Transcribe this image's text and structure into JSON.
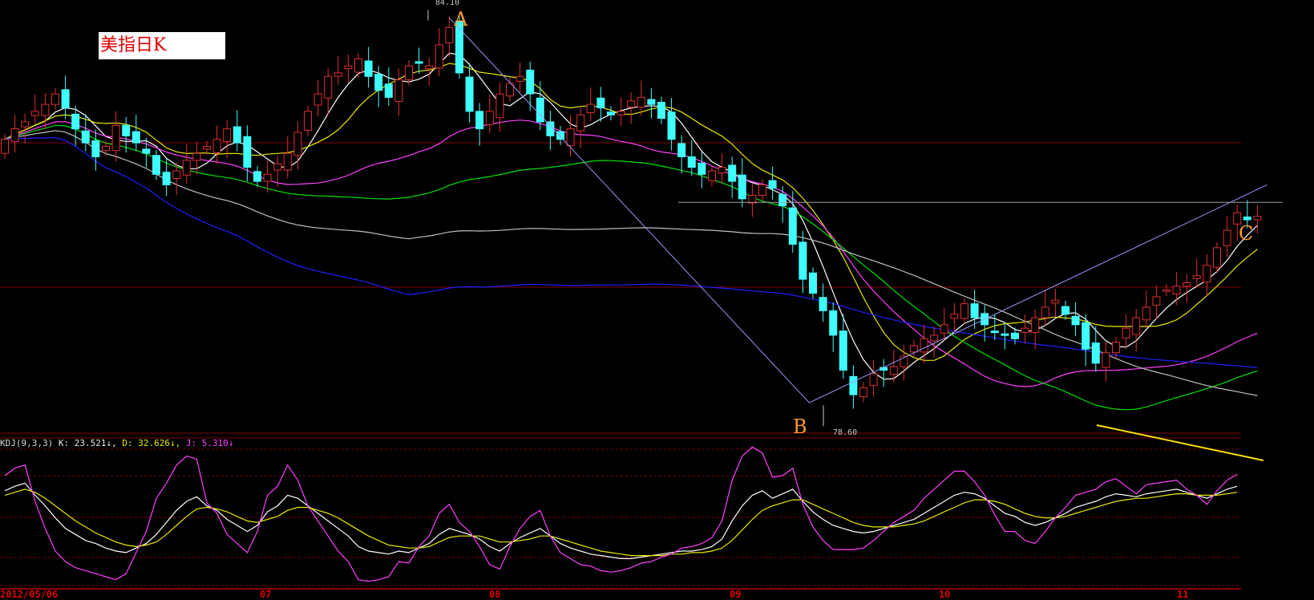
{
  "chart_title": "美指日K",
  "kdj": {
    "params": "KDJ(9,3,3)",
    "k_text": "K: 23.521",
    "d_text": "D: 32.626",
    "j_text": "J: 5.310",
    "k_value": 23.521,
    "d_value": 32.626,
    "j_value": 5.31
  },
  "annotations": {
    "point_a": "A",
    "point_b": "B",
    "point_c": "C",
    "high_label": "84.10",
    "low_label": "78.60"
  },
  "x_axis": {
    "first_date": "2012/05/06",
    "months": [
      "07",
      "08",
      "09",
      "10",
      "11"
    ]
  },
  "colors": {
    "background": "#000000",
    "up_candle": "#e03030",
    "down_candle": "#40ffff",
    "ma5": "#ffffff",
    "ma10": "#e8e800",
    "ma20": "#ff40ff",
    "ma30": "#00e000",
    "ma60": "#c0c0c0",
    "ma120": "#2020ff",
    "label_orange": "#ff9a30",
    "grid_red": "#800000"
  },
  "chart_data": [
    {
      "type": "candlestick",
      "title": "美指日K",
      "x_start_label": "2012/05/06",
      "x_month_labels": [
        "07",
        "08",
        "09",
        "10",
        "11"
      ],
      "y_range": [
        78.2,
        84.3
      ],
      "high": 84.1,
      "low": 78.6,
      "closes": [
        82.4,
        82.55,
        82.65,
        82.8,
        82.9,
        83.05,
        82.85,
        82.55,
        82.35,
        82.15,
        82.3,
        82.6,
        82.45,
        82.35,
        82.2,
        81.9,
        81.75,
        81.95,
        82.1,
        82.2,
        82.3,
        82.4,
        82.55,
        82.35,
        82.0,
        81.8,
        81.9,
        82.05,
        82.2,
        82.5,
        82.8,
        83.05,
        83.3,
        83.35,
        83.45,
        83.55,
        83.3,
        83.1,
        83.0,
        83.25,
        83.45,
        83.5,
        83.45,
        83.75,
        84.0,
        83.35,
        82.8,
        82.55,
        82.8,
        83.05,
        83.2,
        83.3,
        83.05,
        82.65,
        82.45,
        82.4,
        82.55,
        82.75,
        82.9,
        82.85,
        82.75,
        82.8,
        82.95,
        83.0,
        82.9,
        82.7,
        82.4,
        82.15,
        82.0,
        81.9,
        81.95,
        82.0,
        81.8,
        81.55,
        81.6,
        81.75,
        81.7,
        81.45,
        80.9,
        80.4,
        80.2,
        79.95,
        79.6,
        79.1,
        78.75,
        78.85,
        79.05,
        79.1,
        79.15,
        79.3,
        79.45,
        79.55,
        79.6,
        79.75,
        79.9,
        80.05,
        79.85,
        79.75,
        79.65,
        79.6,
        79.55,
        79.7,
        79.85,
        80.0,
        80.1,
        79.9,
        79.75,
        79.4,
        79.2,
        79.35,
        79.5,
        79.7,
        79.85,
        80.0,
        80.15,
        80.25,
        80.3,
        80.35,
        80.45,
        80.6,
        80.85,
        81.1,
        81.35,
        81.25,
        81.3
      ]
    },
    {
      "type": "line",
      "title": "KDJ(9,3,3)",
      "series": [
        {
          "name": "K",
          "values": [
            65,
            68,
            70,
            62,
            55,
            47,
            40,
            36,
            32,
            30,
            27,
            25,
            24,
            27,
            30,
            36,
            44,
            52,
            58,
            61,
            55,
            52,
            46,
            42,
            38,
            42,
            51,
            55,
            62,
            60,
            55,
            50,
            45,
            40,
            35,
            28,
            25,
            24,
            23,
            25,
            24,
            27,
            30,
            36,
            40,
            38,
            36,
            33,
            28,
            25,
            30,
            34,
            37,
            40,
            35,
            30,
            27,
            25,
            23,
            22,
            21,
            20,
            20,
            21,
            22,
            23,
            24,
            25,
            25,
            26,
            28,
            33,
            45,
            55,
            62,
            65,
            60,
            63,
            66,
            58,
            51,
            46,
            42,
            40,
            38,
            37,
            38,
            40,
            42,
            44,
            46,
            50,
            54,
            58,
            62,
            64,
            63,
            60,
            55,
            50,
            48,
            44,
            42,
            44,
            47,
            50,
            54,
            56,
            58,
            61,
            63,
            62,
            61,
            63,
            64,
            65,
            66,
            64,
            62,
            60,
            63,
            66,
            68
          ]
        },
        {
          "name": "D",
          "values": [
            62,
            64,
            66,
            64,
            60,
            55,
            50,
            45,
            41,
            37,
            34,
            31,
            29,
            28,
            29,
            31,
            36,
            42,
            48,
            53,
            54,
            53,
            51,
            48,
            45,
            44,
            46,
            48,
            52,
            54,
            54,
            52,
            50,
            47,
            43,
            39,
            35,
            32,
            29,
            28,
            27,
            27,
            28,
            31,
            34,
            35,
            35,
            35,
            33,
            31,
            31,
            32,
            33,
            35,
            35,
            33,
            31,
            29,
            27,
            25,
            24,
            23,
            22,
            22,
            22,
            22,
            23,
            23,
            24,
            24,
            25,
            27,
            32,
            39,
            46,
            52,
            55,
            57,
            59,
            59,
            56,
            53,
            50,
            47,
            44,
            42,
            41,
            41,
            41,
            42,
            43,
            45,
            48,
            51,
            54,
            57,
            59,
            59,
            58,
            56,
            53,
            50,
            48,
            47,
            47,
            48,
            50,
            52,
            54,
            56,
            58,
            59,
            60,
            60,
            61,
            62,
            63,
            63,
            62,
            62,
            62,
            63,
            64
          ]
        },
        {
          "name": "J",
          "values": [
            75,
            80,
            82,
            58,
            40,
            25,
            18,
            14,
            12,
            10,
            8,
            6,
            10,
            24,
            38,
            60,
            70,
            82,
            88,
            86,
            57,
            50,
            36,
            30,
            24,
            38,
            62,
            68,
            82,
            72,
            55,
            45,
            35,
            25,
            18,
            6,
            5,
            6,
            8,
            18,
            17,
            28,
            35,
            50,
            56,
            44,
            38,
            28,
            16,
            13,
            28,
            40,
            48,
            52,
            35,
            24,
            20,
            16,
            15,
            12,
            11,
            12,
            14,
            17,
            18,
            21,
            23,
            27,
            28,
            30,
            34,
            45,
            72,
            88,
            94,
            90,
            74,
            75,
            80,
            56,
            41,
            32,
            26,
            26,
            26,
            27,
            32,
            38,
            44,
            48,
            52,
            60,
            66,
            72,
            78,
            78,
            71,
            62,
            49,
            38,
            38,
            32,
            30,
            38,
            47,
            54,
            62,
            64,
            66,
            71,
            73,
            68,
            63,
            69,
            70,
            71,
            72,
            66,
            62,
            56,
            65,
            72,
            76
          ]
        }
      ]
    }
  ]
}
